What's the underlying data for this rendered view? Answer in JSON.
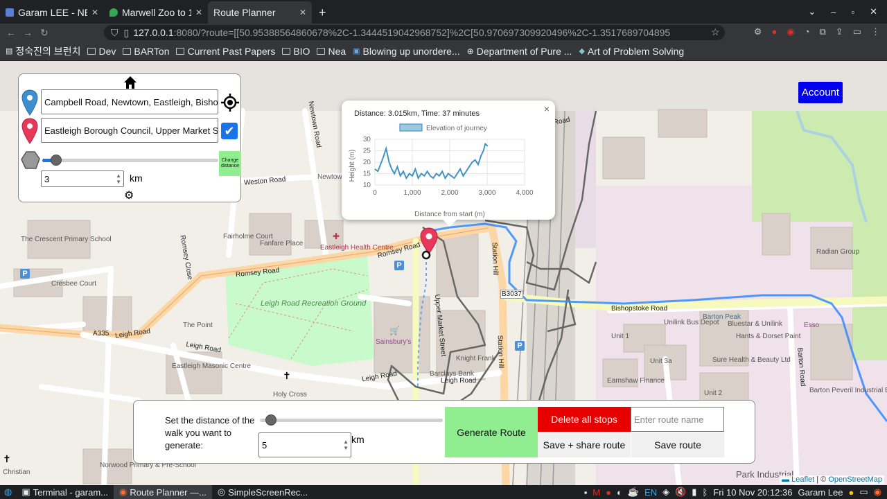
{
  "browser": {
    "tabs": [
      {
        "title": "Garam LEE - NEA",
        "favicon_color": "#5b7fd6"
      },
      {
        "title": "Marwell Zoo to 1",
        "favicon_color": "#34a853"
      },
      {
        "title": "Route Planner",
        "favicon_color": "#35363a"
      }
    ],
    "url_host": "127.0.0.1",
    "url_rest": ":8080/?route=[[50.95388564860678%2C-1.3444519042968752]%2C[50.970697309920496%2C-1.3517689704895",
    "bookmarks": [
      {
        "label": "정숙진의 브런치",
        "icon": "page-icon"
      },
      {
        "label": "Dev",
        "icon": "folder-icon"
      },
      {
        "label": "BARTon",
        "icon": "folder-icon"
      },
      {
        "label": "Current Past Papers",
        "icon": "folder-icon"
      },
      {
        "label": "BIO",
        "icon": "folder-icon"
      },
      {
        "label": "Nea",
        "icon": "folder-icon"
      },
      {
        "label": "Blowing up unordere...",
        "icon": "page-icon"
      },
      {
        "label": "Department of Pure ...",
        "icon": "globe-icon"
      },
      {
        "label": "Art of Problem Solving",
        "icon": "page-icon"
      }
    ]
  },
  "panel": {
    "start_value": "Campbell Road, Newtown, Eastleigh, Bishops",
    "end_value": "Eastleigh Borough Council, Upper Market Str",
    "distance_value": "3",
    "distance_unit": "km",
    "change_distance_label": "Change distance",
    "slider_fraction": 0.08
  },
  "popup": {
    "summary": "Distance: 3.015km, Time: 37 minutes",
    "close": "×"
  },
  "chart_data": {
    "type": "line",
    "title": "",
    "legend": "Elevation of journey",
    "xlabel": "Distance from start (m)",
    "ylabel": "Height (m)",
    "xlim": [
      0,
      4000
    ],
    "ylim": [
      10,
      30
    ],
    "xticks": [
      "0",
      "1,000",
      "2,000",
      "3,000",
      "4,000"
    ],
    "yticks": [
      "10",
      "15",
      "20",
      "25",
      "30"
    ],
    "series": [
      {
        "x": [
          0,
          80,
          150,
          220,
          300,
          380,
          450,
          520,
          600,
          680,
          760,
          840,
          920,
          1000,
          1080,
          1160,
          1240,
          1320,
          1400,
          1480,
          1560,
          1640,
          1720,
          1800,
          1880,
          1960,
          2040,
          2120,
          2200,
          2280,
          2360,
          2440,
          2520,
          2600,
          2680,
          2760,
          2840,
          2900,
          2950,
          3015
        ],
        "y": [
          17,
          16,
          19,
          22,
          26,
          20,
          17,
          15,
          18,
          14,
          16,
          13,
          15,
          14,
          17,
          13,
          15,
          14,
          16,
          14,
          13,
          15,
          14,
          16,
          13,
          15,
          14,
          13,
          15,
          17,
          14,
          16,
          18,
          20,
          21,
          19,
          23,
          25,
          28,
          27
        ]
      }
    ]
  },
  "account_label": "Account",
  "bottom": {
    "label": "Set the distance of the walk you want to generate:",
    "distance_value": "5",
    "unit": "km",
    "slider_fraction": 0.06,
    "generate_label": "Generate Route",
    "delete_label": "Delete all stops",
    "route_name_placeholder": "Enter route name",
    "save_share_label": "Save + share route",
    "save_label": "Save route"
  },
  "attribution": {
    "leaflet": "Leaflet",
    "separator": "| ©",
    "osm": "OpenStreetMap"
  },
  "map_labels": [
    {
      "text": "The Crescent Primary School",
      "kind": "poi"
    },
    {
      "text": "Cresbee Court",
      "kind": "poi"
    },
    {
      "text": "Fairholme Court",
      "kind": "poi"
    },
    {
      "text": "Fanfare Place",
      "kind": "poi"
    },
    {
      "text": "Newtown House",
      "kind": "poi"
    },
    {
      "text": "Eastleigh Health Centre",
      "kind": "poi"
    },
    {
      "text": "Leigh Road Recreation Ground",
      "kind": "park"
    },
    {
      "text": "The Point",
      "kind": "poi"
    },
    {
      "text": "Sainsbury's",
      "kind": "poi"
    },
    {
      "text": "Knight Frank",
      "kind": "poi"
    },
    {
      "text": "Barclays Bank",
      "kind": "poi"
    },
    {
      "text": "Eastleigh Masonic Centre",
      "kind": "poi"
    },
    {
      "text": "Holy Cross",
      "kind": "poi"
    },
    {
      "text": "Radian Group",
      "kind": "poi"
    },
    {
      "text": "Unilink Bus Depot",
      "kind": "poi"
    },
    {
      "text": "Bluestar & Unilink",
      "kind": "poi"
    },
    {
      "text": "Hants & Dorset Paint",
      "kind": "poi"
    },
    {
      "text": "Sure Health & Beauty Ltd",
      "kind": "poi"
    },
    {
      "text": "Earnshaw Finance",
      "kind": "poi"
    },
    {
      "text": "Barton Peveril Industrial Estate",
      "kind": "poi"
    },
    {
      "text": "Park Industrial",
      "kind": "poi"
    },
    {
      "text": "Norwood Primary & Pre-School",
      "kind": "poi"
    },
    {
      "text": "Christian",
      "kind": "poi"
    },
    {
      "text": "Unit 1",
      "kind": "poi"
    },
    {
      "text": "Unit 3a",
      "kind": "poi"
    },
    {
      "text": "Unit 2",
      "kind": "poi"
    },
    {
      "text": "Esso",
      "kind": "poi"
    },
    {
      "text": "Barton Peak",
      "kind": "poi"
    }
  ],
  "road_labels": [
    {
      "text": "Weston Road"
    },
    {
      "text": "Romsey Road"
    },
    {
      "text": "Romsey Road"
    },
    {
      "text": "Romsey Close"
    },
    {
      "text": "Leigh Road"
    },
    {
      "text": "Leigh Road"
    },
    {
      "text": "Leigh Road"
    },
    {
      "text": "Leigh Road"
    },
    {
      "text": "A335"
    },
    {
      "text": "Upper Market Street"
    },
    {
      "text": "Station Hill"
    },
    {
      "text": "Station Hill"
    },
    {
      "text": "Bishopstoke Road"
    },
    {
      "text": "Barton Road"
    },
    {
      "text": "Northlands Road"
    },
    {
      "text": "Newtown Road"
    },
    {
      "text": "B3037"
    }
  ],
  "taskbar": {
    "items": [
      {
        "label": "Terminal - garam..."
      },
      {
        "label": "Route Planner —..."
      },
      {
        "label": "SimpleScreenRec..."
      }
    ],
    "lang": "EN",
    "clock": "Fri 10 Nov 20:12:36",
    "user": "Garam Lee"
  }
}
